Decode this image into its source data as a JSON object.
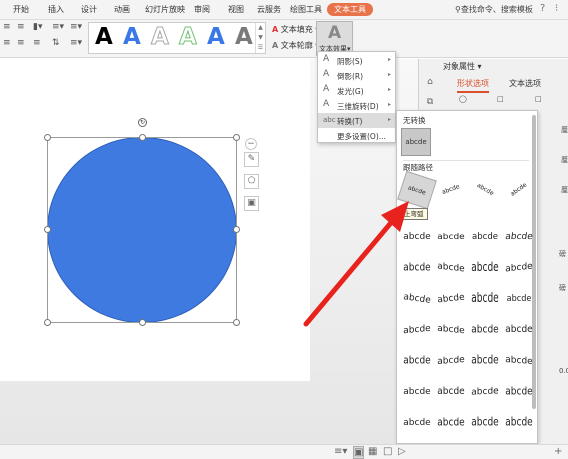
{
  "menubar": {
    "tabs": [
      "开始",
      "插入",
      "设计",
      "动画",
      "幻灯片放映",
      "审阅",
      "视图",
      "云服务",
      "绘图工具",
      "文本工具"
    ],
    "active_tab": "文本工具",
    "search": "查找命令、搜索模板",
    "help": "?",
    "more": "⁝"
  },
  "ribbon": {
    "gallery_letters": [
      "A",
      "A",
      "A",
      "A",
      "A",
      "A"
    ],
    "gallery_colors": [
      "#000000",
      "#3b78e7",
      "#a6a6a6",
      "#72c072",
      "#3b78e7",
      "#7a7a7a"
    ],
    "text_fill": "文本填充",
    "text_outline": "文本轮廓",
    "text_effect": "文本效果"
  },
  "menu": {
    "items": [
      {
        "label": "阴影(S)",
        "icon": "A",
        "arrow": true
      },
      {
        "label": "倒影(R)",
        "icon": "A",
        "arrow": true
      },
      {
        "label": "发光(G)",
        "icon": "A",
        "arrow": true
      },
      {
        "label": "三维旋转(D)",
        "icon": "A",
        "arrow": true
      },
      {
        "label": "转换(T)",
        "icon": "abc",
        "arrow": true,
        "highlighted": true
      },
      {
        "label": "更多设置(O)...",
        "icon": "",
        "arrow": false
      }
    ]
  },
  "submenu": {
    "no_transform_header": "无转换",
    "no_transform_sample": "abcde",
    "follow_path_header": "跟随路径",
    "tooltip": "上弯弧",
    "grid_sample": "abcde",
    "warp_rows": 7,
    "warp_cols": 4
  },
  "pane": {
    "title": "对象属性",
    "tabs": [
      "形状选项",
      "文本选项"
    ],
    "partial_values": [
      "厘",
      "厘",
      "厘",
      "磅",
      "磅",
      "0.0°"
    ]
  },
  "tool_icons": [
    "collapse-icon",
    "pencil-icon",
    "shape-outline-icon",
    "frame-icon"
  ]
}
